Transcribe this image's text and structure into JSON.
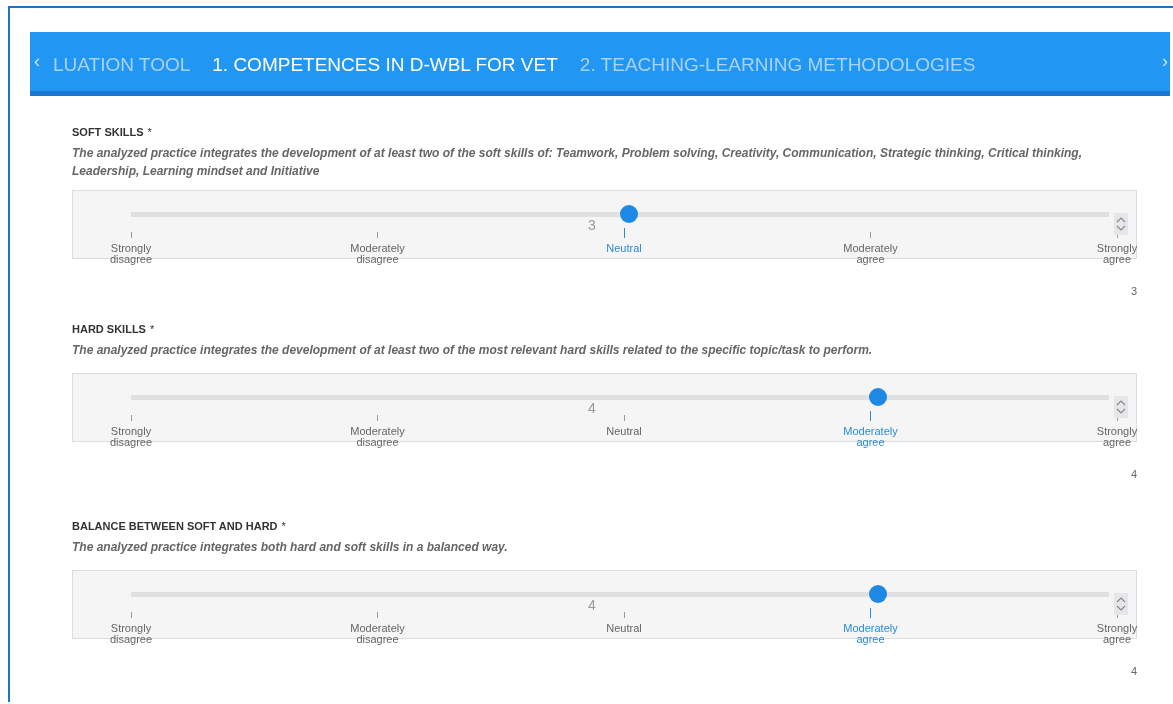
{
  "tabs": [
    {
      "label": "LUATION TOOL",
      "selected": false
    },
    {
      "label": "1. COMPETENCES IN D-WBL FOR VET",
      "selected": true
    },
    {
      "label": "2. TEACHING-LEARNING METHODOLOGIES",
      "selected": false
    }
  ],
  "scroll_left": "‹",
  "scroll_right": "›",
  "questions": [
    {
      "title": "SOFT SKILLS",
      "required": "*",
      "description": "The analyzed practice integrates the development of at least two of the soft skills of: Teamwork, Problem solving, Creativity, Communication, Strategic thinking, Critical thinking, Leadership, Learning mindset and Initiative",
      "slider_value": "3",
      "level": 0.5,
      "scale": [
        {
          "label": "Strongly disagree",
          "selected": false
        },
        {
          "label": "Moderately disagree",
          "selected": false
        },
        {
          "label": "Neutral",
          "selected": true
        },
        {
          "label": "Moderately agree",
          "selected": false
        },
        {
          "label": "Strongly agree",
          "selected": false
        }
      ],
      "value": "3"
    },
    {
      "title": "HARD SKILLS",
      "required": "*",
      "description": "The analyzed practice integrates the development of at least two of the most relevant hard skills related to the specific topic/task to perform.",
      "slider_value": "4",
      "level": 0.75,
      "scale": [
        {
          "label": "Strongly disagree",
          "selected": false
        },
        {
          "label": "Moderately disagree",
          "selected": false
        },
        {
          "label": "Neutral",
          "selected": false
        },
        {
          "label": "Moderately agree",
          "selected": true
        },
        {
          "label": "Strongly agree",
          "selected": false
        }
      ],
      "value": "4"
    },
    {
      "title": "BALANCE BETWEEN SOFT AND HARD",
      "required": "*",
      "description": "The analyzed practice integrates both hard and soft skills in a balanced way.",
      "slider_value": "4",
      "level": 0.75,
      "scale": [
        {
          "label": "Strongly disagree",
          "selected": false
        },
        {
          "label": "Moderately disagree",
          "selected": false
        },
        {
          "label": "Neutral",
          "selected": false
        },
        {
          "label": "Moderately agree",
          "selected": true
        },
        {
          "label": "Strongly agree",
          "selected": false
        }
      ],
      "value": "4"
    }
  ]
}
